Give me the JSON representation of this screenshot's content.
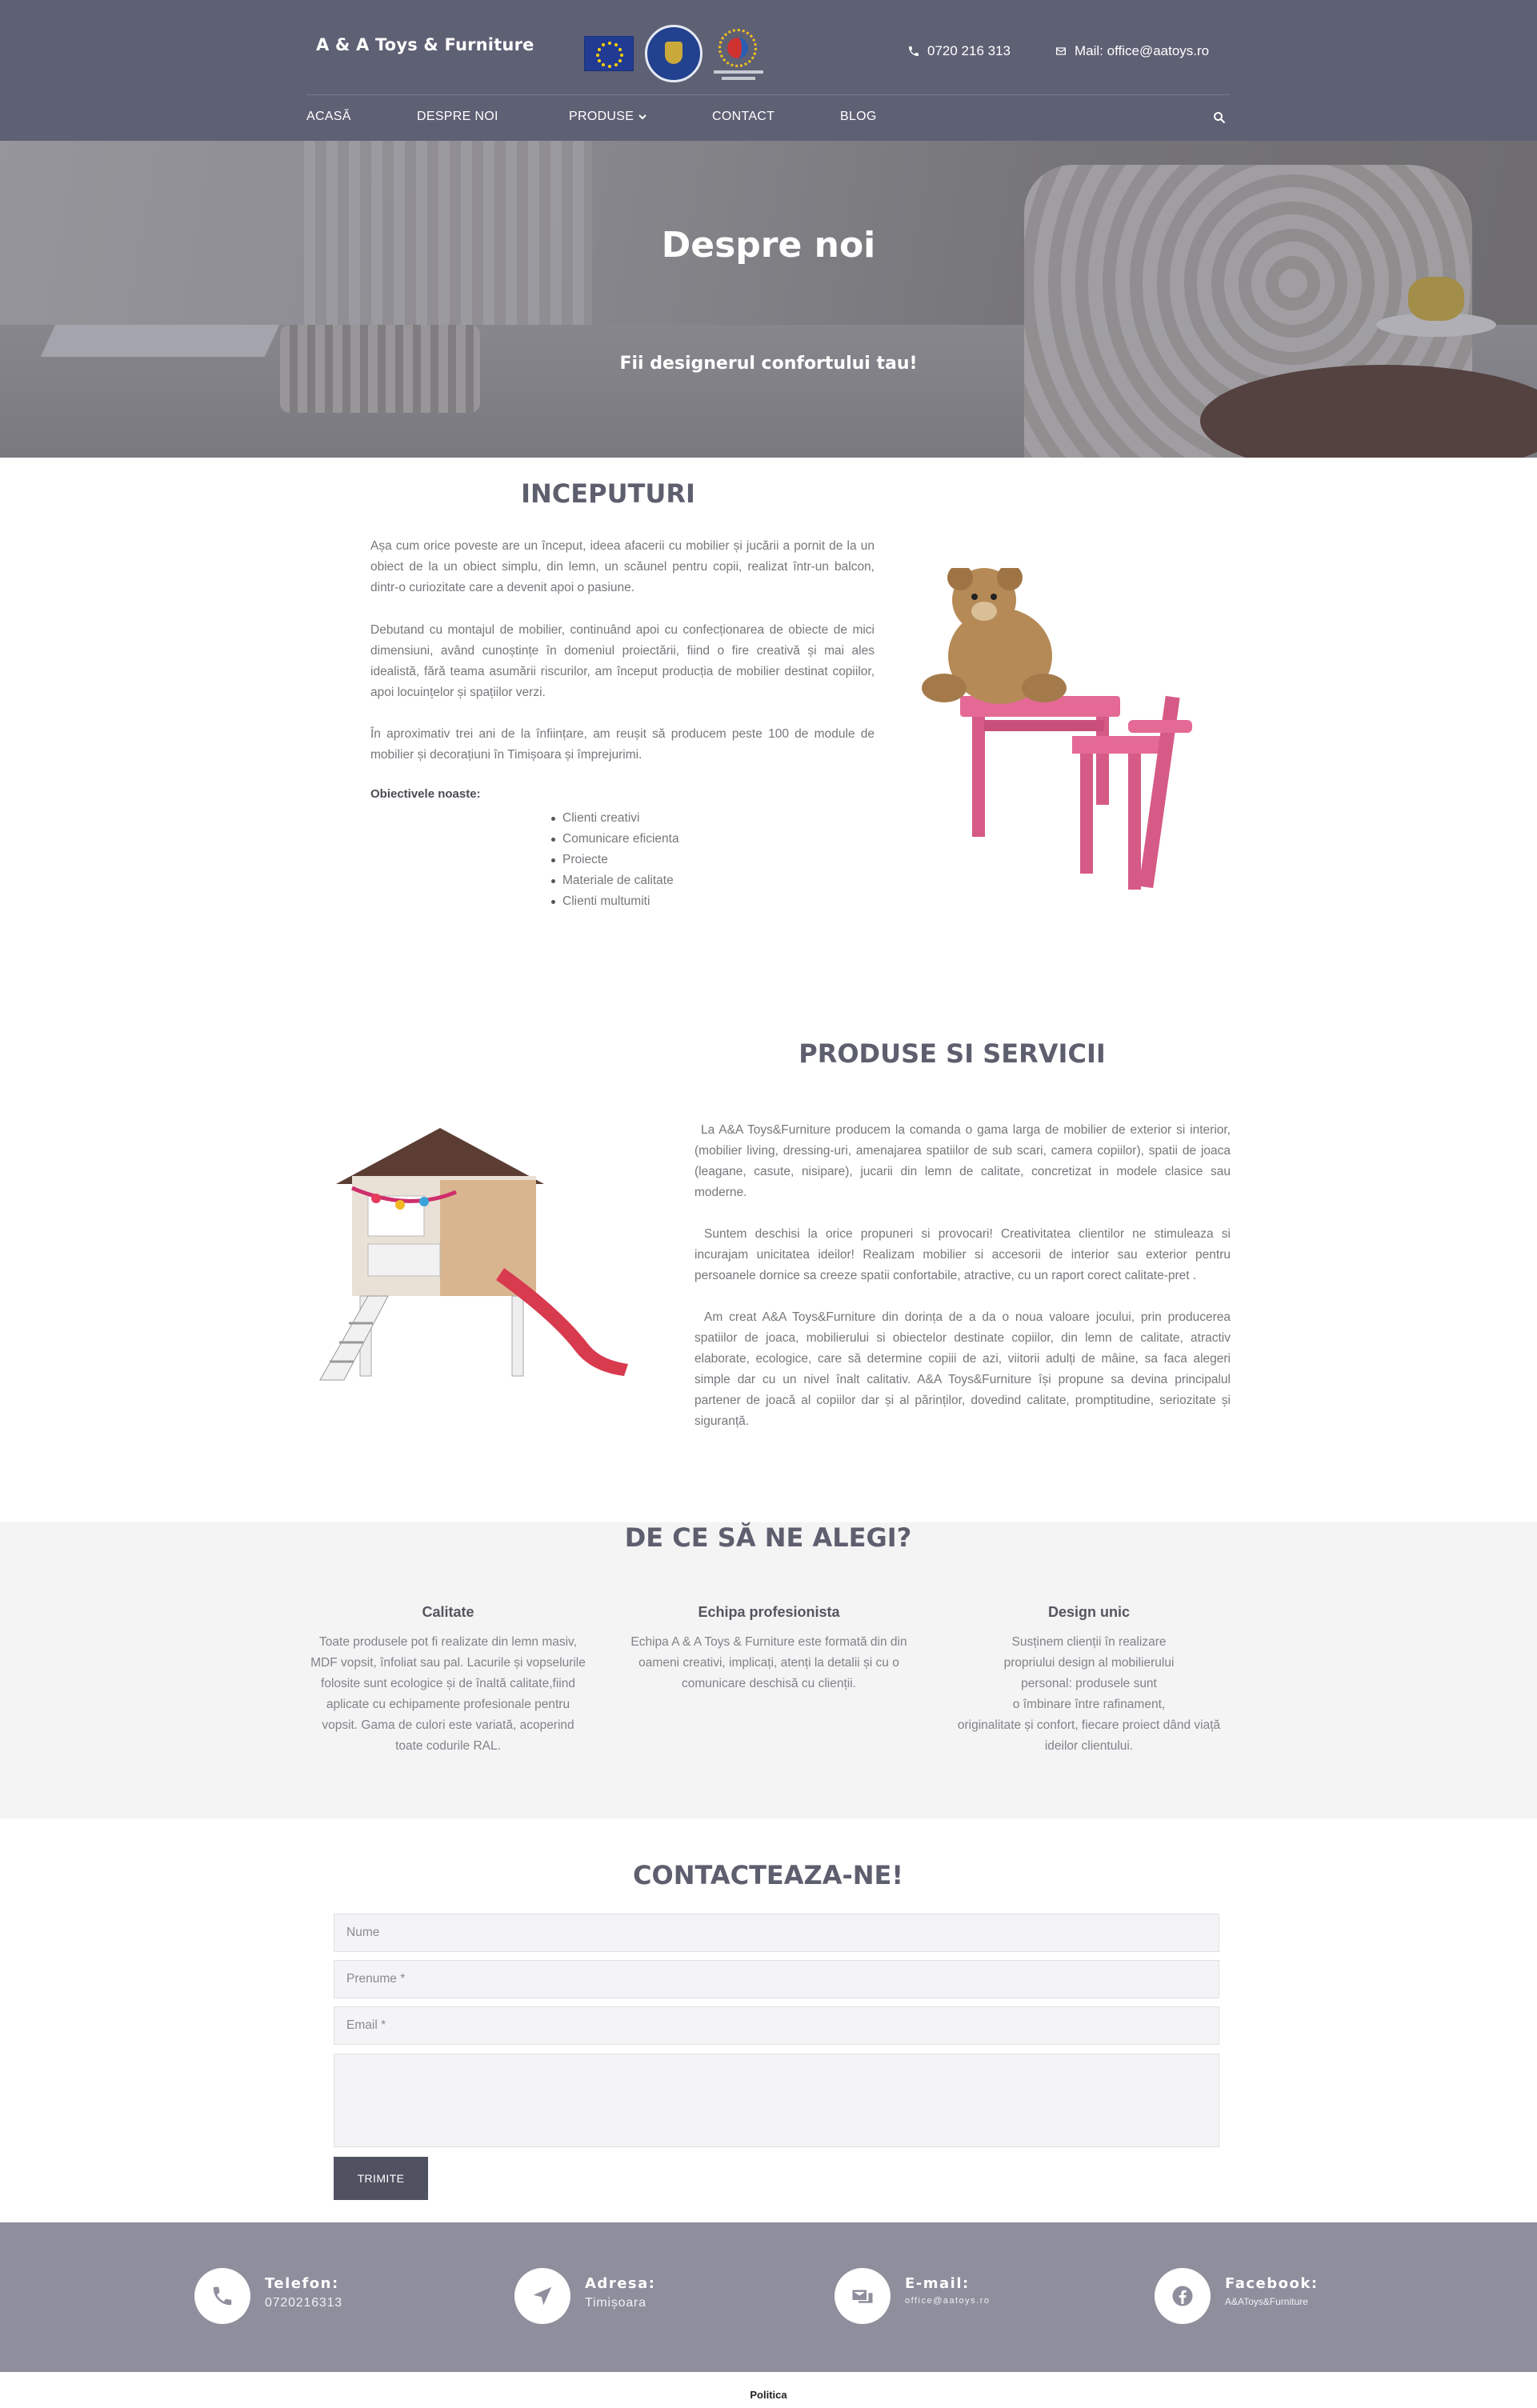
{
  "header": {
    "brand": "A & A Toys & Furniture",
    "phone": "0720 216 313",
    "mail": "Mail: office@aatoys.ro",
    "logos": [
      "eu-flag-logo",
      "romanian-government-logo",
      "regional-program-logo"
    ]
  },
  "nav": {
    "items": [
      "ACASĂ",
      "DESPRE NOI",
      "PRODUSE",
      "CONTACT",
      "BLOG"
    ],
    "search_icon": "search-icon"
  },
  "hero": {
    "title": "Despre noi",
    "subtitle": "Fii designerul confortului tau!"
  },
  "inceputuri": {
    "title": "INCEPUTURI",
    "paragraphs": [
      "Așa cum orice poveste are un început, ideea afacerii cu mobilier și jucării a pornit de la un obiect de la un obiect simplu, din lemn, un scăunel pentru copii, realizat într-un balcon, dintr-o curiozitate care a devenit apoi o pasiune.",
      "Debutand cu montajul de mobilier, continuând apoi cu confecționarea de  obiecte de mici dimensiuni, având cunoștințe în domeniul proiectării, fiind o fire creativă și mai ales idealistă, fără teama asumării riscurilor, am început producția de mobilier destinat copiilor, apoi locuințelor și spațiilor verzi.",
      "În aproximativ trei ani de la înființare, am reușit să producem peste 100 de module de mobilier și decorațiuni în Timișoara și împrejurimi."
    ],
    "objectives_label": "Obiectivele noaste:",
    "objectives": [
      "Clienti creativi",
      "Comunicare eficienta",
      "Proiecte",
      "Materiale de calitate",
      "Clienti multumiti"
    ]
  },
  "produse": {
    "title": "PRODUSE SI SERVICII",
    "paragraphs": [
      "La A&A Toys&Furniture producem la comanda o gama larga de mobilier de exterior si interior, (mobilier living, dressing-uri, amenajarea spatiilor de sub scari, camera copiilor), spatii de joaca (leagane, casute, nisipare), jucarii din lemn de calitate, concretizat in modele clasice sau moderne.",
      "Suntem deschisi la orice propuneri si provocari! Creativitatea clientilor ne stimuleaza si incurajam unicitatea ideilor! Realizam mobilier si accesorii de interior sau exterior pentru persoanele dornice sa creeze spatii confortabile, atractive, cu un raport corect calitate-pret .",
      "Am creat A&A Toys&Furniture din dorința de a da o noua valoare jocului, prin producerea spatiilor de joaca, mobilierului si obiectelor destinate copiilor, din lemn de calitate, atractiv elaborate, ecologice, care să determine copiii de azi, viitorii adulți de mâine, sa faca alegeri simple dar cu un nivel înalt calitativ.  A&A Toys&Furniture își propune sa devina principalul partener de joacă al copiilor dar și al părinților, dovedind calitate, promptitudine, seriozitate și siguranță."
    ]
  },
  "why": {
    "title": "DE CE SĂ NE ALEGI?",
    "columns": [
      {
        "title": "Calitate",
        "lines": [
          "Toate produsele pot fi realizate din lemn masiv,",
          "MDF vopsit, înfoliat sau pal. Lacurile și vopselurile",
          "folosite sunt ecologice și de înaltă calitate,fiind",
          "aplicate cu echipamente profesionale pentru",
          "vopsit. Gama de culori este variată, acoperind",
          "toate codurile RAL."
        ]
      },
      {
        "title": "Echipa profesionista",
        "lines": [
          "Echipa A & A Toys & Furniture este formată din din",
          "oameni creativi, implicați, atenți la detalii și cu o",
          "comunicare deschisă cu clienții."
        ]
      },
      {
        "title": "Design unic",
        "lines": [
          "Susținem clienții în realizare",
          "propriului design al mobilierului",
          "personal: produsele sunt",
          "o îmbinare între rafinament,",
          "originalitate și confort, fiecare proiect dând viață",
          "ideilor clientului."
        ]
      }
    ]
  },
  "contact": {
    "title": "CONTACTEAZA-NE!",
    "name_placeholder": "Nume",
    "surname_placeholder": "Prenume *",
    "email_placeholder": "Email *",
    "message_placeholder": "",
    "submit_label": "TRIMITE"
  },
  "footer": {
    "items": [
      {
        "label": "Telefon:",
        "value": "0720216313",
        "icon": "phone-icon"
      },
      {
        "label": "Adresa:",
        "value": "Timișoara",
        "icon": "location-arrow-icon"
      },
      {
        "label": "E-mail:",
        "value": "office@aatoys.ro",
        "icon": "mail-icon"
      },
      {
        "label": "Facebook:",
        "value": "A&AToys&Furniture",
        "icon": "facebook-icon"
      }
    ]
  },
  "bottom": {
    "policy_link": "Politica"
  }
}
